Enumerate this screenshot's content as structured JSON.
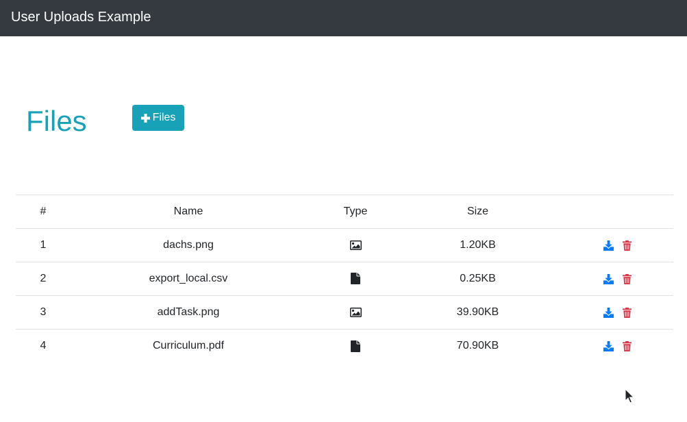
{
  "navbar": {
    "brand": "User Uploads Example"
  },
  "page": {
    "title": "Files",
    "add_button_label": "Files"
  },
  "table": {
    "headers": {
      "num": "#",
      "name": "Name",
      "type": "Type",
      "size": "Size",
      "actions": ""
    },
    "rows": [
      {
        "num": "1",
        "name": "dachs.png",
        "type_icon": "image-icon",
        "size": "1.20KB"
      },
      {
        "num": "2",
        "name": "export_local.csv",
        "type_icon": "file-icon",
        "size": "0.25KB"
      },
      {
        "num": "3",
        "name": "addTask.png",
        "type_icon": "image-icon",
        "size": "39.90KB"
      },
      {
        "num": "4",
        "name": "Curriculum.pdf",
        "type_icon": "file-icon",
        "size": "70.90KB"
      }
    ]
  },
  "colors": {
    "navbar_bg": "#343a40",
    "accent": "#17a2b8",
    "download": "#007bff",
    "delete": "#dc3545",
    "border": "#dee2e6"
  },
  "icons": {
    "add": "plus-icon",
    "download": "download-icon",
    "delete": "trash-icon"
  }
}
